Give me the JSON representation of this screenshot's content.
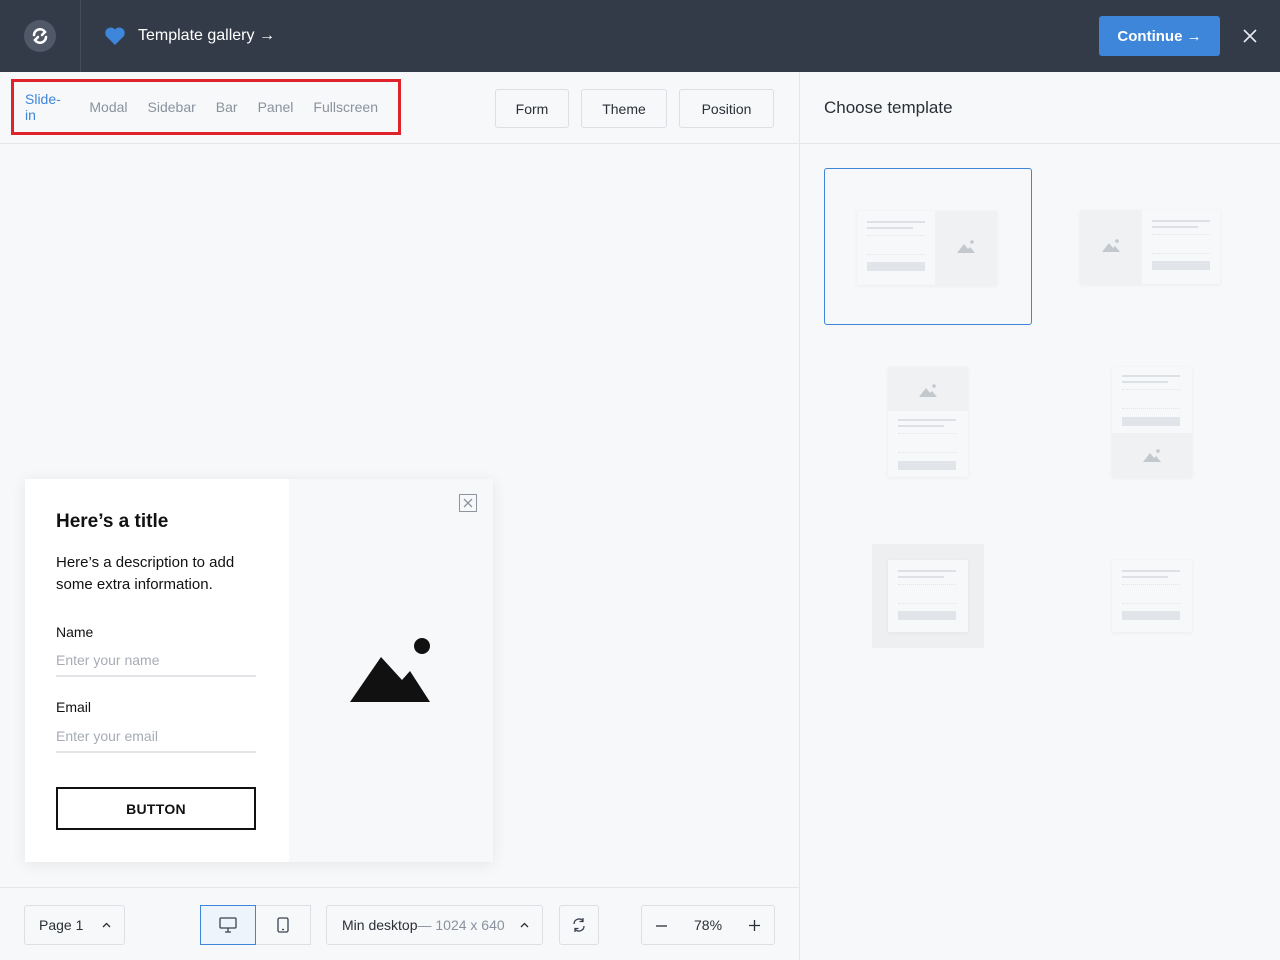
{
  "topbar": {
    "gallery_title": "Template gallery →",
    "continue_label": "Continue →"
  },
  "toolbar": {
    "types": [
      "Slide-in",
      "Modal",
      "Sidebar",
      "Bar",
      "Panel",
      "Fullscreen"
    ],
    "active_type": "Slide-in",
    "form_label": "Form",
    "theme_label": "Theme",
    "position_label": "Position"
  },
  "popup": {
    "title": "Here’s a title",
    "description": "Here’s a description to add some extra information.",
    "name_label": "Name",
    "name_placeholder": "Enter your name",
    "email_label": "Email",
    "email_placeholder": "Enter your email",
    "button_label": "BUTTON"
  },
  "bottombar": {
    "page_label": "Page 1",
    "viewport_label": "Min desktop",
    "viewport_size": "— 1024 x 640",
    "zoom": "78%"
  },
  "right_panel": {
    "title": "Choose template",
    "selected_template": 0
  },
  "colors": {
    "accent": "#3d86d9",
    "topbar": "#343b48",
    "highlight": "#e0232b"
  }
}
